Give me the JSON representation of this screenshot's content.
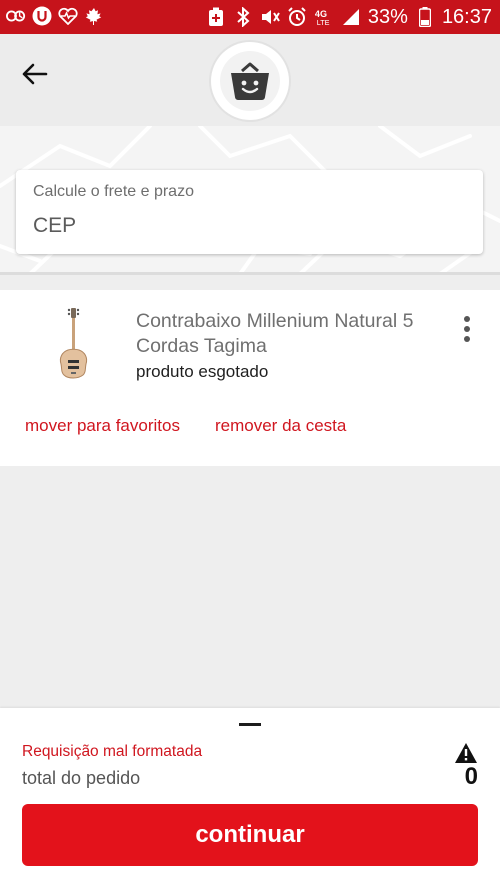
{
  "status_bar": {
    "battery": "33%",
    "time": "16:37",
    "network": "4G",
    "left_icons": [
      "data-usage-icon",
      "u-app-icon",
      "heart-rate-icon",
      "maple-leaf-icon"
    ],
    "right_icons": [
      "battery-saver-icon",
      "bluetooth-icon",
      "mute-icon",
      "alarm-icon",
      "lte-icon",
      "signal-icon",
      "battery-icon"
    ]
  },
  "header": {
    "back_icon": "arrow-left-icon",
    "logo_icon": "smiling-basket-icon"
  },
  "shipping": {
    "label": "Calcule o frete e prazo",
    "placeholder": "CEP",
    "value": ""
  },
  "cart": {
    "items": [
      {
        "name": "Contrabaixo Millenium Natural 5 Cordas Tagima",
        "status": "produto esgotado",
        "image_icon": "bass-guitar-image",
        "actions": {
          "favorite": "mover para favoritos",
          "remove": "remover da cesta"
        }
      }
    ]
  },
  "summary": {
    "error": "Requisição mal formatada",
    "total_label": "total do pedido",
    "total_value": "0",
    "warning_icon": "warning-icon",
    "continue": "continuar"
  },
  "colors": {
    "brand_red": "#c6131b",
    "button_red": "#e3121b",
    "link_red": "#d0161f"
  }
}
